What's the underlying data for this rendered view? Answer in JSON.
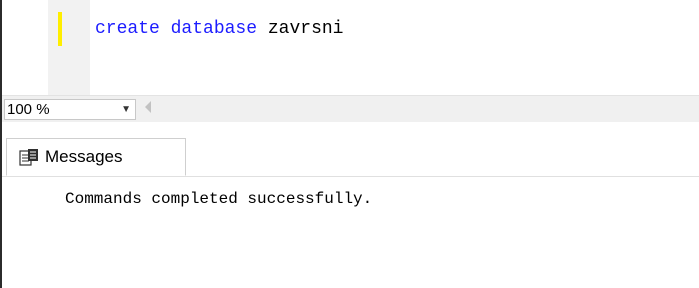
{
  "editor": {
    "code_keyword_create": "create",
    "code_space_1": " ",
    "code_keyword_database": "database",
    "code_space_2": " ",
    "code_identifier": "zavrsni"
  },
  "zoom": {
    "value": "100 %",
    "dropdown_icon": "chevron-down-icon"
  },
  "results": {
    "tabs": [
      {
        "label": "Messages",
        "icon": "messages-icon"
      }
    ],
    "message": "Commands completed successfully."
  },
  "colors": {
    "keyword": "#1c1cff",
    "change_bar": "#ffee00",
    "toolbar_bg": "#f0f0f0"
  }
}
